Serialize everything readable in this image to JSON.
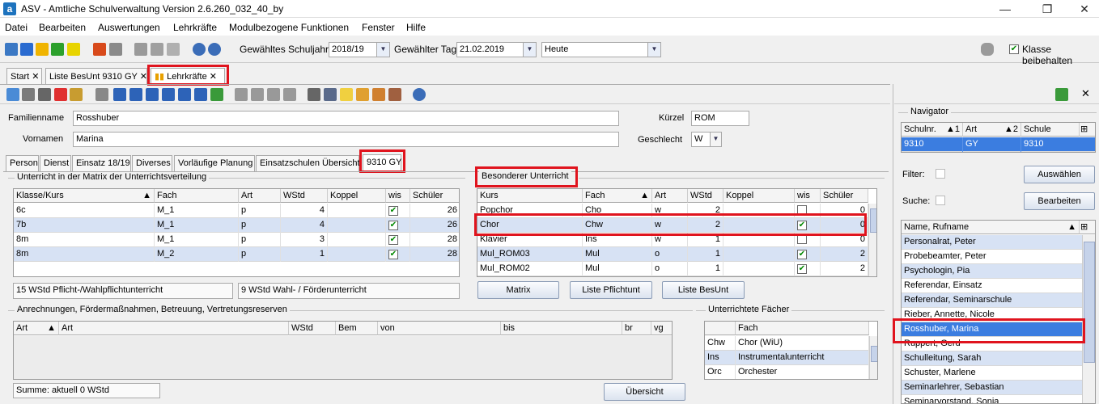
{
  "window": {
    "title": "ASV - Amtliche Schulverwaltung Version 2.6.260_032_40_by",
    "logo": "a"
  },
  "menu": [
    "Datei",
    "Bearbeiten",
    "Auswertungen",
    "Lehrkräfte",
    "Modulbezogene Funktionen",
    "Fenster",
    "Hilfe"
  ],
  "toolbar": {
    "schuljahr_label": "Gewähltes Schuljahr",
    "schuljahr_value": "2018/19",
    "tag_label": "Gewählter Tag",
    "tag_value": "21.02.2019",
    "heute_value": "Heute",
    "klasse_label": "Klasse beibehalten"
  },
  "doc_tabs": [
    "Start",
    "Liste BesUnt 9310 GY",
    "Lehrkräfte"
  ],
  "person": {
    "familienname_label": "Familienname",
    "familienname": "Rosshuber",
    "vornamen_label": "Vornamen",
    "vornamen": "Marina",
    "kuerzel_label": "Kürzel",
    "kuerzel": "ROM",
    "geschlecht_label": "Geschlecht",
    "geschlecht": "W"
  },
  "sub_tabs": [
    "Person",
    "Dienst",
    "Einsatz 18/19",
    "Diverses",
    "Vorläufige Planung",
    "Einsatzschulen Übersicht",
    "9310 GY"
  ],
  "matrix": {
    "title": "Unterricht in der Matrix der Unterrichtsverteilung",
    "headers": [
      "Klasse/Kurs",
      "Fach",
      "Art",
      "WStd",
      "Koppel",
      "wis",
      "Schüler"
    ],
    "rows": [
      {
        "klasse": "6c",
        "fach": "M_1",
        "art": "p",
        "wstd": "4",
        "koppel": "",
        "wis": "✔",
        "schueler": "26"
      },
      {
        "klasse": "7b",
        "fach": "M_1",
        "art": "p",
        "wstd": "4",
        "koppel": "",
        "wis": "✔",
        "schueler": "26"
      },
      {
        "klasse": "8m",
        "fach": "M_1",
        "art": "p",
        "wstd": "3",
        "koppel": "",
        "wis": "✔",
        "schueler": "28"
      },
      {
        "klasse": "8m",
        "fach": "M_2",
        "art": "p",
        "wstd": "1",
        "koppel": "",
        "wis": "✔",
        "schueler": "28"
      }
    ],
    "sum_pflicht": "15 WStd Pflicht-/Wahlpflichtunterricht",
    "sum_wahl": "9 WStd Wahl- / Förderunterricht"
  },
  "besonderer": {
    "title": "Besonderer Unterricht",
    "headers": [
      "Kurs",
      "Fach",
      "Art",
      "WStd",
      "Koppel",
      "wis",
      "Schüler"
    ],
    "rows": [
      {
        "kurs": "Popchor",
        "fach": "Cho",
        "art": "w",
        "wstd": "2",
        "koppel": "",
        "wis": "",
        "schueler": "0"
      },
      {
        "kurs": "Chor",
        "fach": "Chw",
        "art": "w",
        "wstd": "2",
        "koppel": "",
        "wis": "✔",
        "schueler": "0"
      },
      {
        "kurs": "Klavier",
        "fach": "Ins",
        "art": "w",
        "wstd": "1",
        "koppel": "",
        "wis": "",
        "schueler": "0"
      },
      {
        "kurs": "Mul_ROM03",
        "fach": "Mul",
        "art": "o",
        "wstd": "1",
        "koppel": "",
        "wis": "✔",
        "schueler": "2"
      },
      {
        "kurs": "Mul_ROM02",
        "fach": "Mul",
        "art": "o",
        "wstd": "1",
        "koppel": "",
        "wis": "✔",
        "schueler": "2"
      }
    ],
    "btn_matrix": "Matrix",
    "btn_pflicht": "Liste Pflichtunt",
    "btn_besunt": "Liste BesUnt"
  },
  "anrechnungen": {
    "title": "Anrechnungen, Fördermaßnahmen, Betreuung, Vertretungsreserven",
    "headers": [
      "Art",
      "Art",
      "WStd",
      "Bem",
      "von",
      "bis",
      "br",
      "vg"
    ],
    "summe": "Summe: aktuell 0 WStd",
    "btn_uebersicht": "Übersicht"
  },
  "faecher": {
    "title": "Unterrichtete Fächer",
    "headers": [
      "",
      "Fach"
    ],
    "rows": [
      {
        "k": "Chw",
        "name": "Chor (WiU)"
      },
      {
        "k": "Ins",
        "name": "Instrumentalunterricht"
      },
      {
        "k": "Orc",
        "name": "Orchester"
      }
    ]
  },
  "navigator": {
    "title": "Navigator",
    "headers": [
      "Schulnr.",
      "1",
      "Art",
      "2",
      "Schule"
    ],
    "school": {
      "nr": "9310",
      "art": "GY",
      "schule": "9310"
    },
    "filter_label": "Filter:",
    "btn_auswaehlen": "Auswählen",
    "suche_label": "Suche:",
    "btn_bearbeiten": "Bearbeiten",
    "list_header": "Name, Rufname",
    "list": [
      "Personalrat, Peter",
      "Probebeamter, Peter",
      "Psychologin, Pia",
      "Referendar, Einsatz",
      "Referendar, Seminarschule",
      "Rieber, Annette, Nicole",
      "Rosshuber, Marina",
      "Ruppert, Gerd",
      "Schulleitung, Sarah",
      "Schuster, Marlene",
      "Seminarlehrer, Sebastian",
      "Seminarvorstand, Sonja"
    ]
  }
}
